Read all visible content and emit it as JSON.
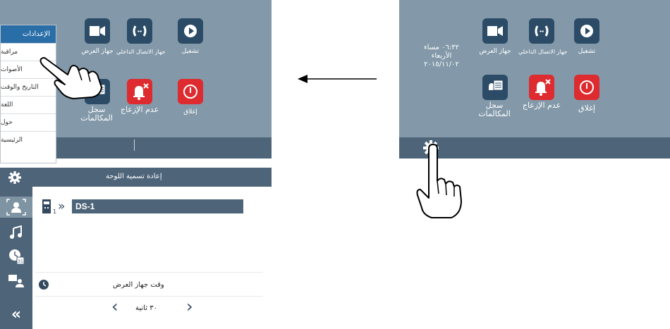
{
  "left_screen": {
    "tiles": [
      {
        "icon": "play-icon",
        "label": "تشغيل",
        "style": "blue"
      },
      {
        "icon": "intercom-icon",
        "label": "جهاز الاتصال الداخلي",
        "style": "blue"
      },
      {
        "icon": "video-camera-icon",
        "label": "جهاز العرض",
        "style": "blue"
      },
      {
        "icon": "power-icon",
        "label": "إغلاق",
        "style": "red"
      },
      {
        "icon": "bell-mute-icon",
        "label": "عدم الإزعاج",
        "style": "red"
      },
      {
        "icon": "call-log-icon",
        "label": "سجل المكالمات",
        "style": "blue"
      }
    ],
    "menu": {
      "title": "الإعدادات",
      "items": [
        "مراقبة",
        "الأصوات",
        "التاريخ والوقت",
        "اللغة",
        "حول",
        "الرئيسية"
      ]
    }
  },
  "right_screen": {
    "datetime": {
      "time": "٠٦:٣٢ مساء",
      "day": "الأربعاء",
      "date": "٢٠١٥/١١/٠٢"
    },
    "tiles": [
      {
        "icon": "play-icon",
        "label": "تشغيل",
        "style": "blue"
      },
      {
        "icon": "intercom-icon",
        "label": "جهاز الاتصال الداخلي",
        "style": "blue"
      },
      {
        "icon": "video-camera-icon",
        "label": "جهاز العرض",
        "style": "blue"
      },
      {
        "icon": "power-icon",
        "label": "إغلاق",
        "style": "red"
      },
      {
        "icon": "bell-mute-icon",
        "label": "عدم الإزعاج",
        "style": "red"
      },
      {
        "icon": "call-log-icon",
        "label": "سجل المكالمات",
        "style": "blue"
      }
    ]
  },
  "bottom_screen": {
    "header_title": "إعادة تسمية اللوحة",
    "panel_index": "1",
    "panel_name": "DS-1",
    "monitor_time_label": "وقت جهاز العرض",
    "duration_value": "٣٠ ثانية"
  },
  "colors": {
    "panel_gray": "#8399a9",
    "bar_dark": "#4d6479",
    "tile_blue": "#2b4b66",
    "tile_red": "#dd2b2f",
    "menu_accent": "#2a6ea8"
  }
}
